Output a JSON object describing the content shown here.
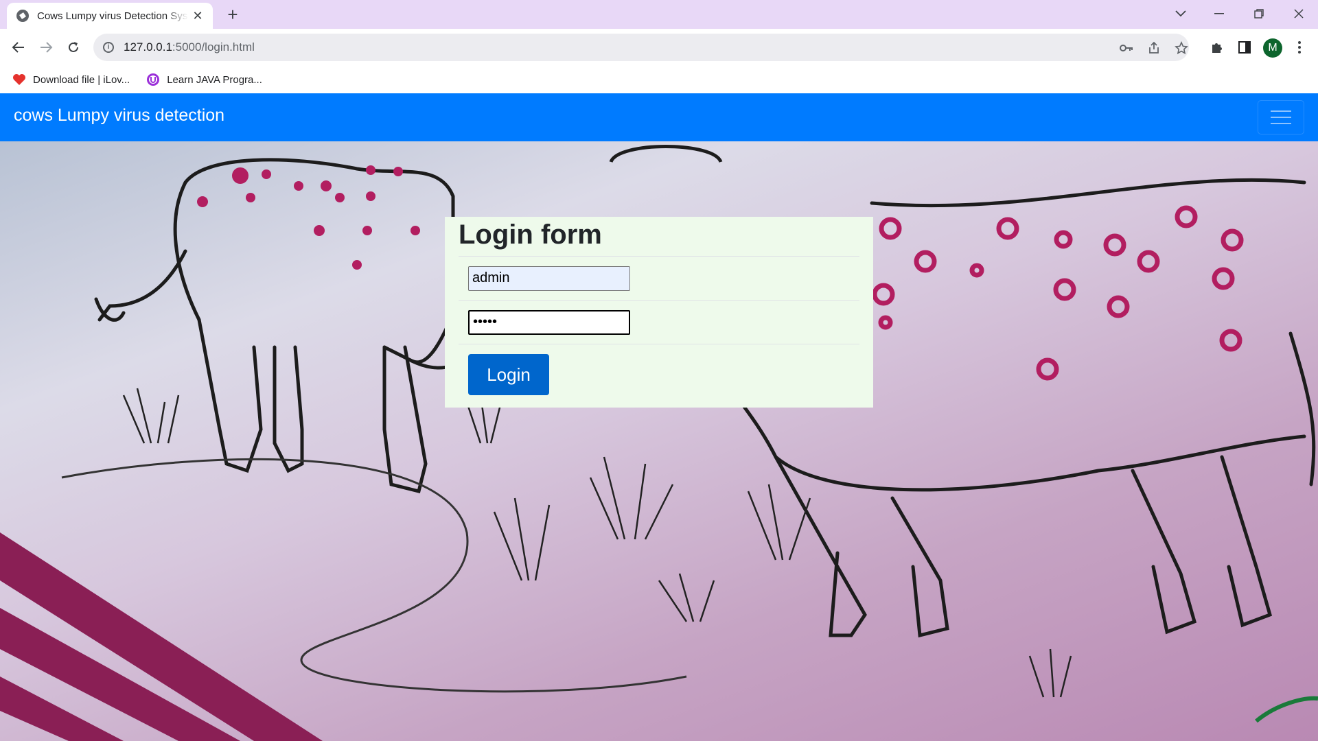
{
  "browser": {
    "tab_title": "Cows Lumpy virus Detection System",
    "url_host": "127.0.0.1",
    "url_rest": ":5000/login.html",
    "avatar_letter": "M",
    "bookmarks": [
      {
        "label": "Download file | iLov...",
        "icon": "heart-icon",
        "color": "#e5322d"
      },
      {
        "label": "Learn JAVA Progra...",
        "icon": "badge-icon",
        "color": "#9b30d9"
      }
    ]
  },
  "navbar": {
    "brand": "cows Lumpy virus detection",
    "color": "#007bff"
  },
  "login": {
    "title": "Login form",
    "username_value": "admin",
    "password_value": "•••••",
    "button_label": "Login",
    "button_color": "#0066cc",
    "card_color": "#eefaeb"
  }
}
